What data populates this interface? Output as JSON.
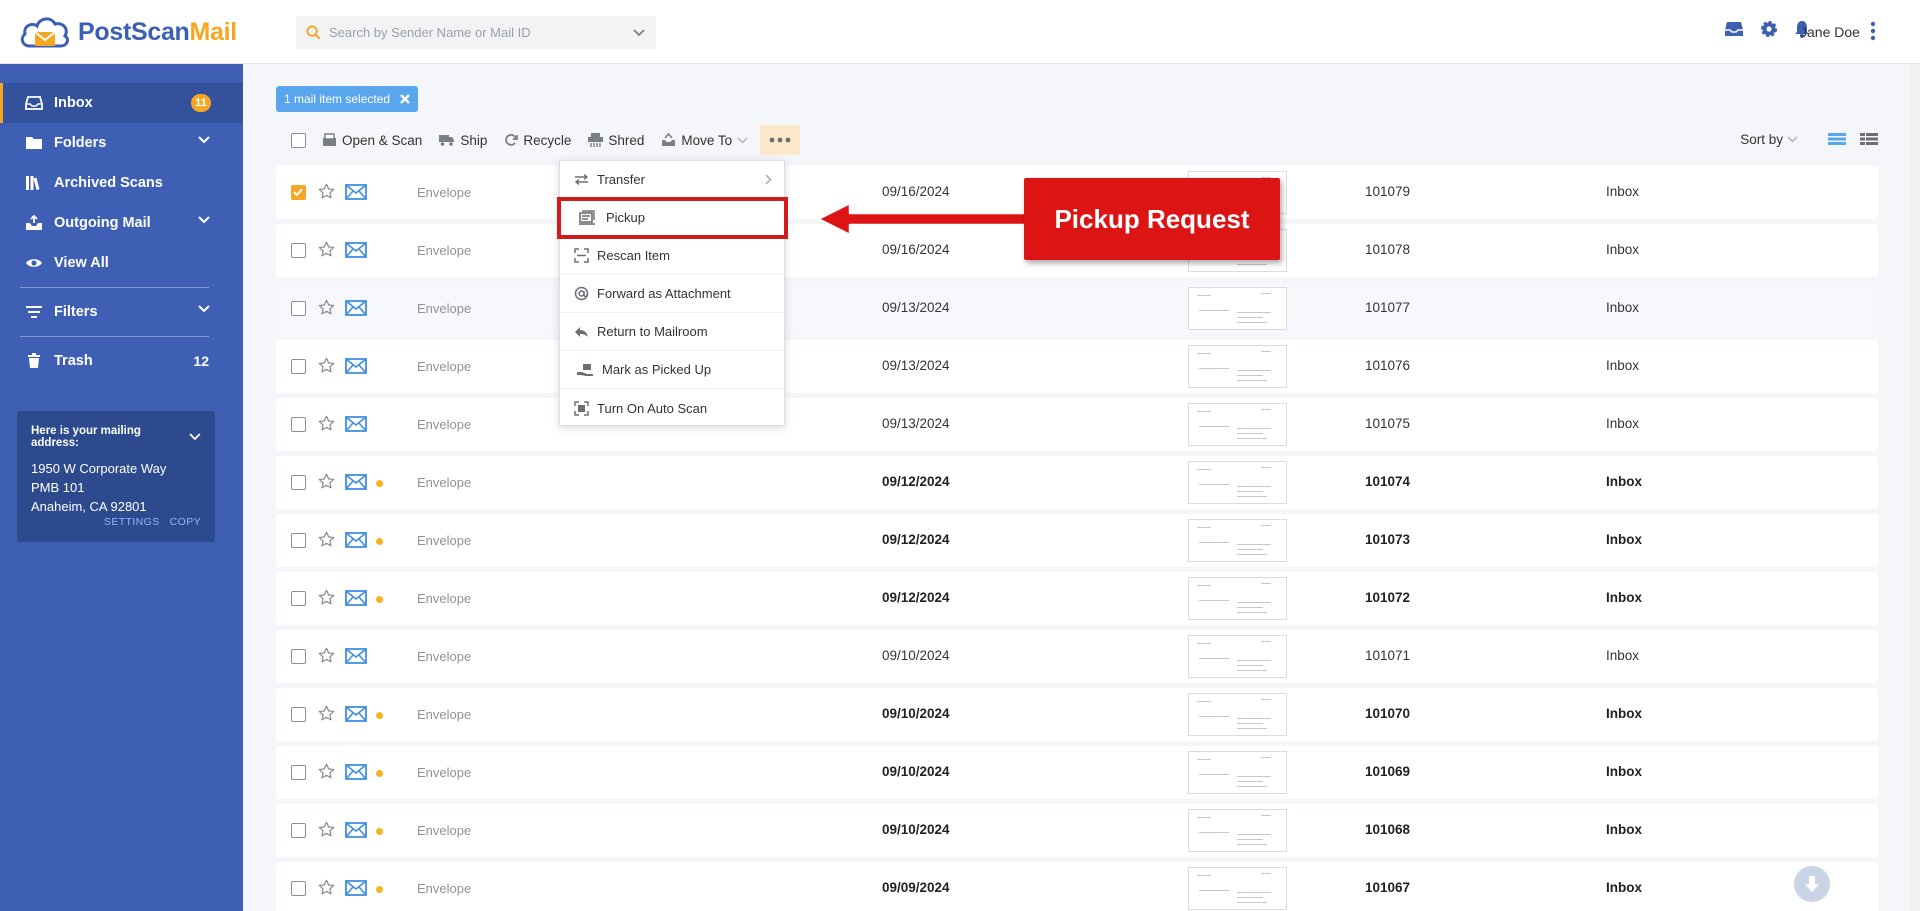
{
  "app": {
    "logo_main": "PostScan",
    "logo_accent": "Mail"
  },
  "header": {
    "search_placeholder": "Search by Sender Name or Mail ID",
    "user_name": "Jane Doe"
  },
  "sidebar": {
    "items": [
      {
        "label": "Inbox",
        "badge": "11"
      },
      {
        "label": "Folders"
      },
      {
        "label": "Archived Scans"
      },
      {
        "label": "Outgoing Mail"
      },
      {
        "label": "View All"
      },
      {
        "label": "Filters"
      },
      {
        "label": "Trash",
        "count": "12"
      }
    ],
    "address": {
      "title": "Here is your mailing address:",
      "line1": "1950 W Corporate Way",
      "line2": "PMB 101",
      "line3": "Anaheim, CA 92801",
      "settings": "SETTINGS",
      "copy": "COPY"
    }
  },
  "selection": {
    "label": "1 mail item selected"
  },
  "toolbar": {
    "open_scan": "Open & Scan",
    "ship": "Ship",
    "recycle": "Recycle",
    "shred": "Shred",
    "move_to": "Move To",
    "sort_by": "Sort by"
  },
  "menu": {
    "items": [
      {
        "label": "Transfer"
      },
      {
        "label": "Pickup"
      },
      {
        "label": "Rescan Item"
      },
      {
        "label": "Forward as Attachment"
      },
      {
        "label": "Return to Mailroom"
      },
      {
        "label": "Mark as Picked Up"
      },
      {
        "label": "Turn On Auto Scan"
      }
    ]
  },
  "callout": {
    "label": "Pickup Request"
  },
  "rows": [
    {
      "type": "Envelope",
      "date": "09/16/2024",
      "id": "101079",
      "folder": "Inbox",
      "checked": true
    },
    {
      "type": "Envelope",
      "date": "09/16/2024",
      "id": "101078",
      "folder": "Inbox"
    },
    {
      "type": "Envelope",
      "date": "09/13/2024",
      "id": "101077",
      "folder": "Inbox"
    },
    {
      "type": "Envelope",
      "date": "09/13/2024",
      "id": "101076",
      "folder": "Inbox"
    },
    {
      "type": "Envelope",
      "date": "09/13/2024",
      "id": "101075",
      "folder": "Inbox"
    },
    {
      "type": "Envelope",
      "date": "09/12/2024",
      "id": "101074",
      "folder": "Inbox",
      "unread": true
    },
    {
      "type": "Envelope",
      "date": "09/12/2024",
      "id": "101073",
      "folder": "Inbox",
      "unread": true
    },
    {
      "type": "Envelope",
      "date": "09/12/2024",
      "id": "101072",
      "folder": "Inbox",
      "unread": true
    },
    {
      "type": "Envelope",
      "date": "09/10/2024",
      "id": "101071",
      "folder": "Inbox"
    },
    {
      "type": "Envelope",
      "date": "09/10/2024",
      "id": "101070",
      "folder": "Inbox",
      "unread": true
    },
    {
      "type": "Envelope",
      "date": "09/10/2024",
      "id": "101069",
      "folder": "Inbox",
      "unread": true
    },
    {
      "type": "Envelope",
      "date": "09/10/2024",
      "id": "101068",
      "folder": "Inbox",
      "unread": true
    },
    {
      "type": "Envelope",
      "date": "09/09/2024",
      "id": "101067",
      "folder": "Inbox",
      "unread": true
    }
  ],
  "colors": {
    "sidebar": "#3e5fb4",
    "accent": "#f5a623",
    "callout": "#dd1414"
  }
}
